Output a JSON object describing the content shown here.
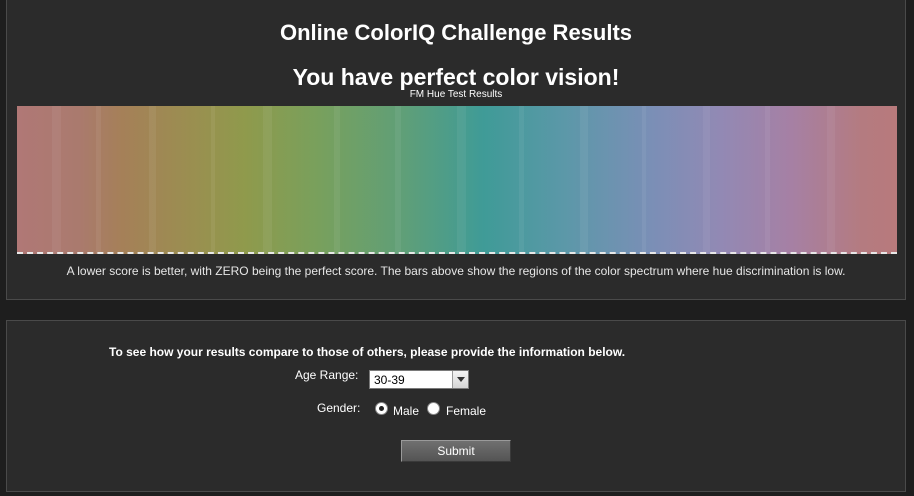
{
  "header": {
    "title": "Online ColorIQ Challenge Results",
    "headline": "You have perfect color vision!"
  },
  "results": {
    "chart_title": "FM Hue Test Results",
    "note": "A lower score is better, with ZERO being the perfect score. The bars above show the regions of the color spectrum where hue discrimination is low."
  },
  "form": {
    "prompt": "To see how your results compare to those of others, please provide the information below.",
    "age_label": "Age Range:",
    "age_value": "30-39",
    "gender_label": "Gender:",
    "gender_options": [
      "Male",
      "Female"
    ],
    "gender_selected": "Male",
    "submit_label": "Submit"
  }
}
